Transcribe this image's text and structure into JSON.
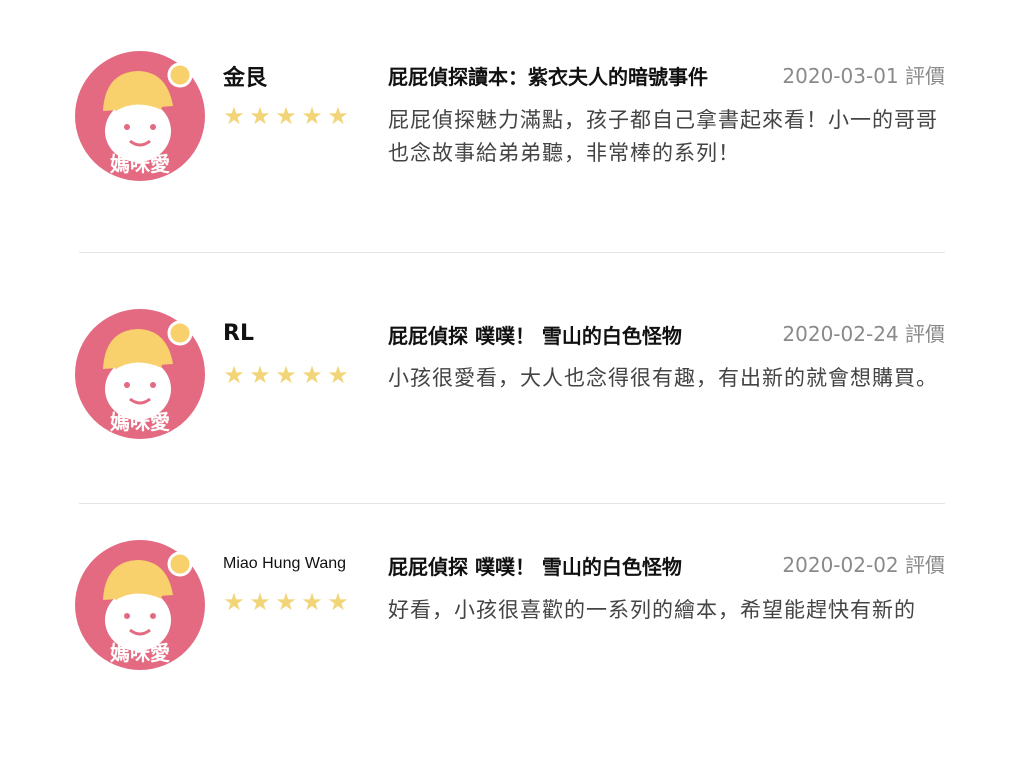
{
  "avatar": {
    "label": "媽咪愛",
    "bg": "#e0627a",
    "hat": "#f9d37a"
  },
  "reviews": [
    {
      "name": "金艮",
      "rating": 5,
      "book_title": "屁屁偵探讀本：紫衣夫人的暗號事件",
      "date": "2020-03-01 評價",
      "comment": "屁屁偵探魅力滿點，孩子都自己拿書起來看！小一的哥哥也念故事給弟弟聽，非常棒的系列！"
    },
    {
      "name": "RL",
      "rating": 5,
      "book_title": "屁屁偵探 噗噗！ 雪山的白色怪物",
      "date": "2020-02-24 評價",
      "comment": "小孩很愛看，大人也念得很有趣，有出新的就會想購買。"
    },
    {
      "name": "Miao Hung Wang",
      "rating": 5,
      "book_title": "屁屁偵探 噗噗！ 雪山的白色怪物",
      "date": "2020-02-02 評價",
      "comment": "好看，小孩很喜歡的一系列的繪本，希望能趕快有新的"
    }
  ]
}
